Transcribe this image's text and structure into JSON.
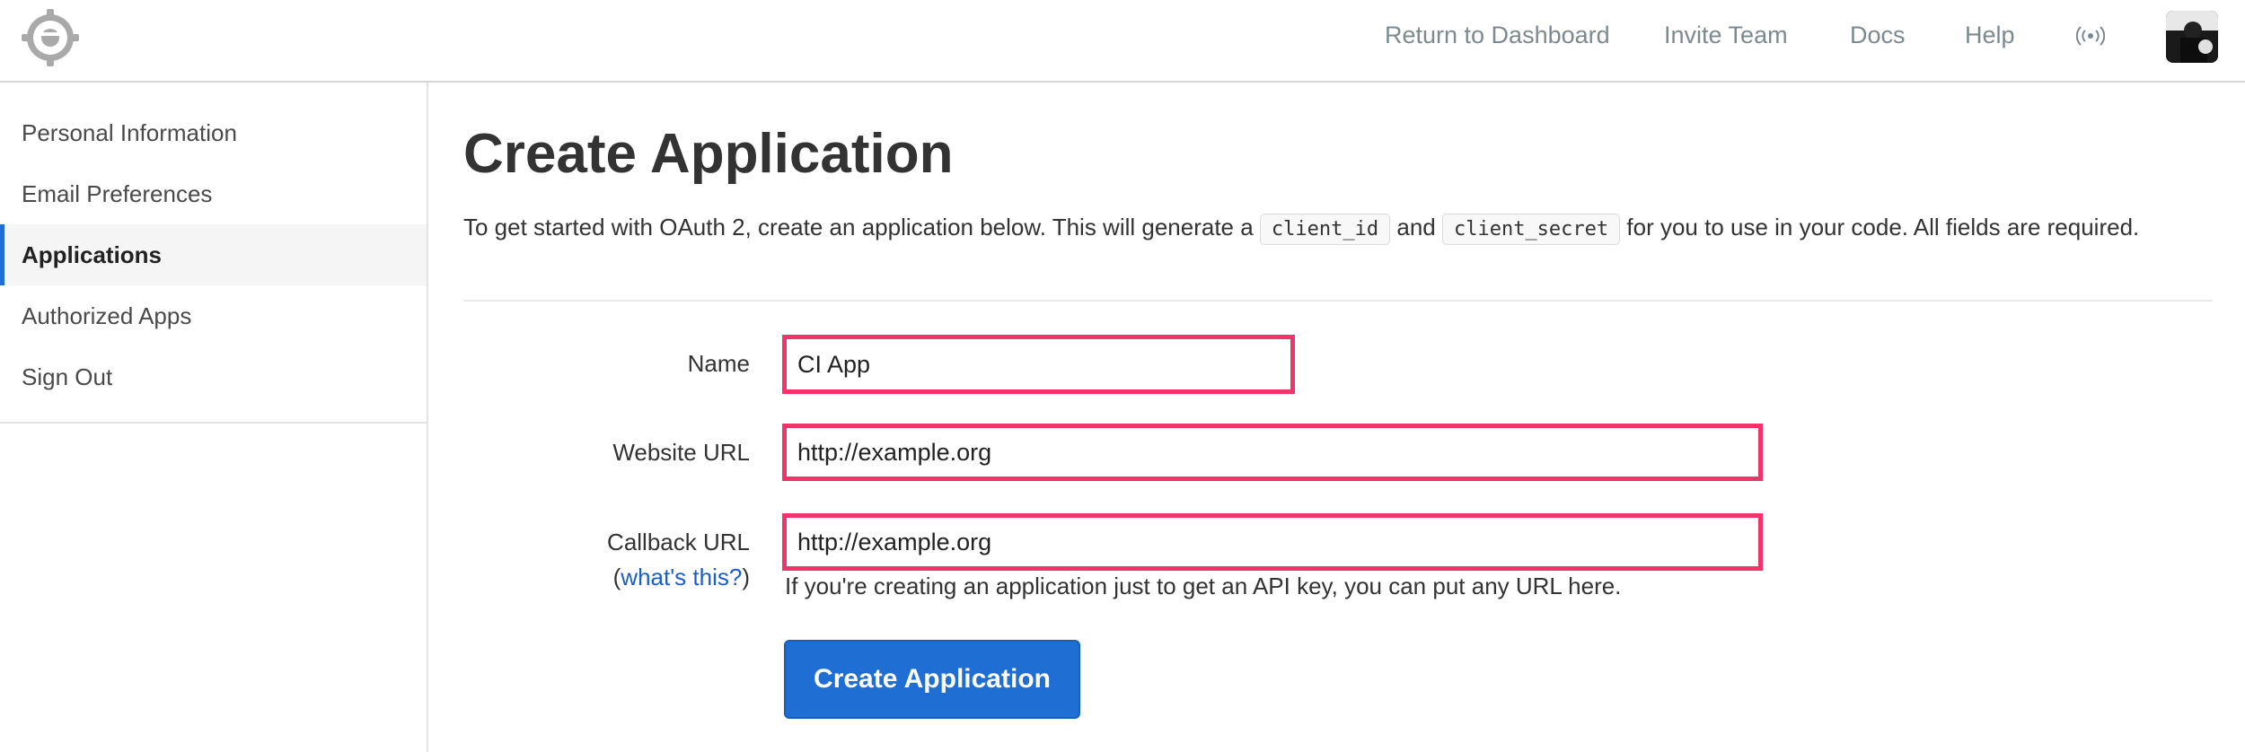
{
  "header": {
    "nav": {
      "return_dashboard": "Return to Dashboard",
      "invite_team": "Invite Team",
      "docs": "Docs",
      "help": "Help"
    },
    "icons": {
      "logo": "gear-logo-icon",
      "notifications": "broadcast-signal-icon",
      "avatar": "user-avatar"
    }
  },
  "sidebar": {
    "items": [
      {
        "label": "Personal Information",
        "active": false
      },
      {
        "label": "Email Preferences",
        "active": false
      },
      {
        "label": "Applications",
        "active": true
      },
      {
        "label": "Authorized Apps",
        "active": false
      },
      {
        "label": "Sign Out",
        "active": false
      }
    ]
  },
  "main": {
    "title": "Create Application",
    "intro": {
      "before": "To get started with OAuth 2, create an application below. This will generate a ",
      "code1": "client_id",
      "middle": " and ",
      "code2": "client_secret",
      "after": " for you to use in your code. All fields are required."
    },
    "form": {
      "name": {
        "label": "Name",
        "value": "CI App"
      },
      "website_url": {
        "label": "Website URL",
        "value": "http://example.org"
      },
      "callback_url": {
        "label": "Callback URL",
        "help_paren_open": "(",
        "help_link": "what's this?",
        "help_paren_close": ")",
        "value": "http://example.org",
        "hint": "If you're creating an application just to get an API key, you can put any URL here."
      },
      "submit_label": "Create Application"
    }
  },
  "colors": {
    "accent": "#1f6ed4",
    "highlight_border": "#f0356b",
    "nav_text": "#7c8a90"
  }
}
